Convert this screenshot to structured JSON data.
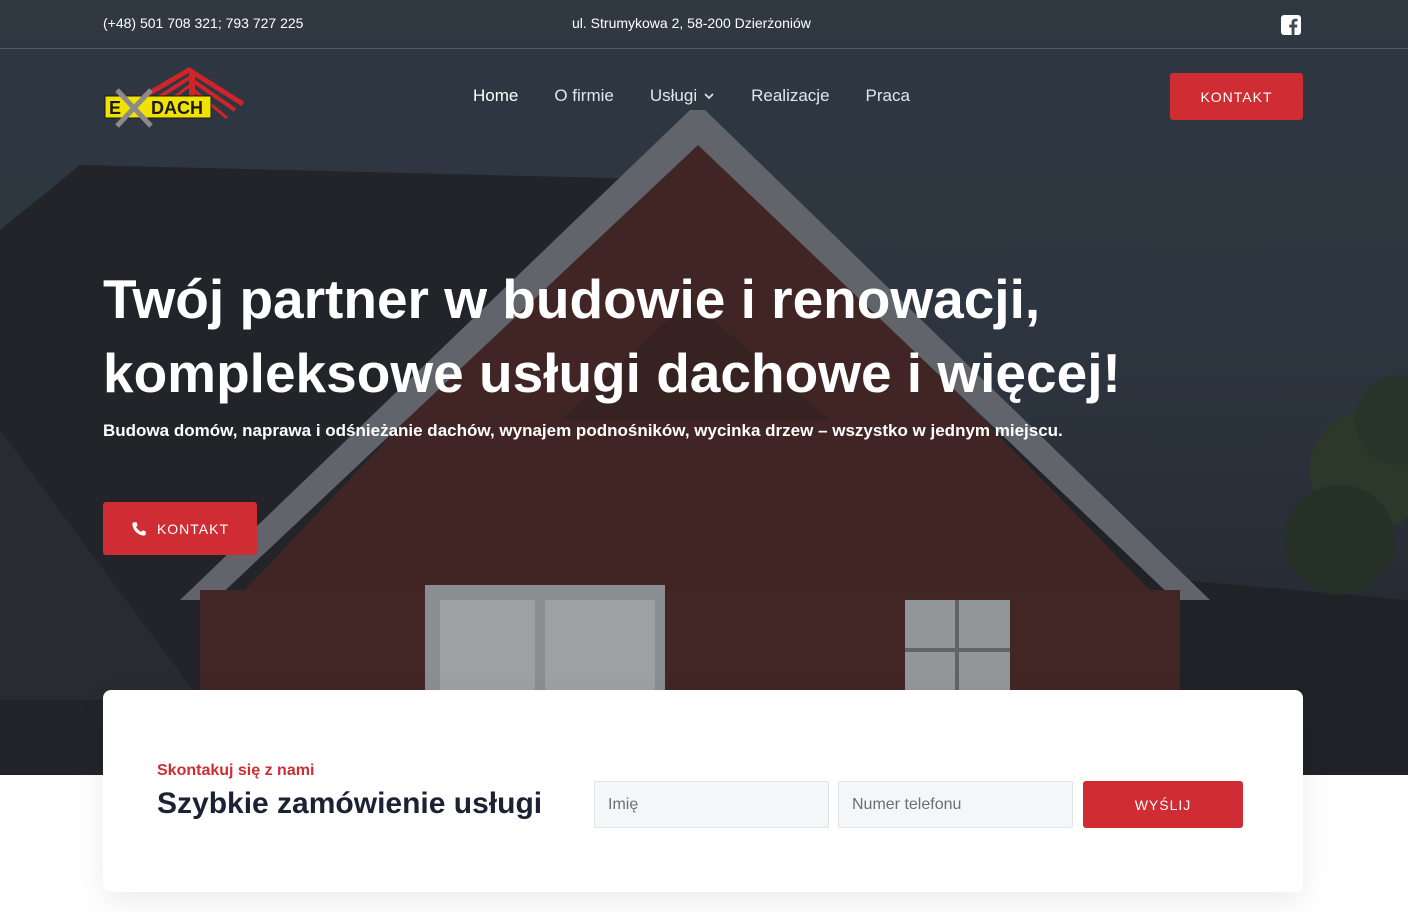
{
  "topbar": {
    "phone": "(+48) 501 708 321; 793 727 225",
    "address": "ul. Strumykowa 2, 58-200 Dzierżoniów",
    "social_icon": "facebook-icon"
  },
  "logo": {
    "text": "EXDACH",
    "colors": {
      "yellow": "#f2e200",
      "red": "#d0242b",
      "gray": "#8a8a8a"
    }
  },
  "nav": {
    "items": [
      {
        "label": "Home"
      },
      {
        "label": "O firmie"
      },
      {
        "label": "Usługi"
      },
      {
        "label": "Realizacje"
      },
      {
        "label": "Praca"
      }
    ],
    "cta_label": "KONTAKT"
  },
  "hero": {
    "headline_line1": "Twój partner w budowie i renowacji,",
    "headline_line2": "kompleksowe usługi dachowe i więcej!",
    "subline": "Budowa domów, naprawa i odśnieżanie dachów, wynajem podnośników, wycinka drzew – wszystko w jednym miejscu.",
    "cta_label": "KONTAKT",
    "cta_icon": "phone-icon"
  },
  "quick_order": {
    "eyebrow": "Skontakuj się z nami",
    "title": "Szybkie zamówienie usługi",
    "name_placeholder": "Imię",
    "phone_placeholder": "Numer telefonu",
    "submit_label": "WYŚLIJ"
  },
  "colors": {
    "accent": "#cf2c33",
    "heading_dark": "#1b2233"
  }
}
